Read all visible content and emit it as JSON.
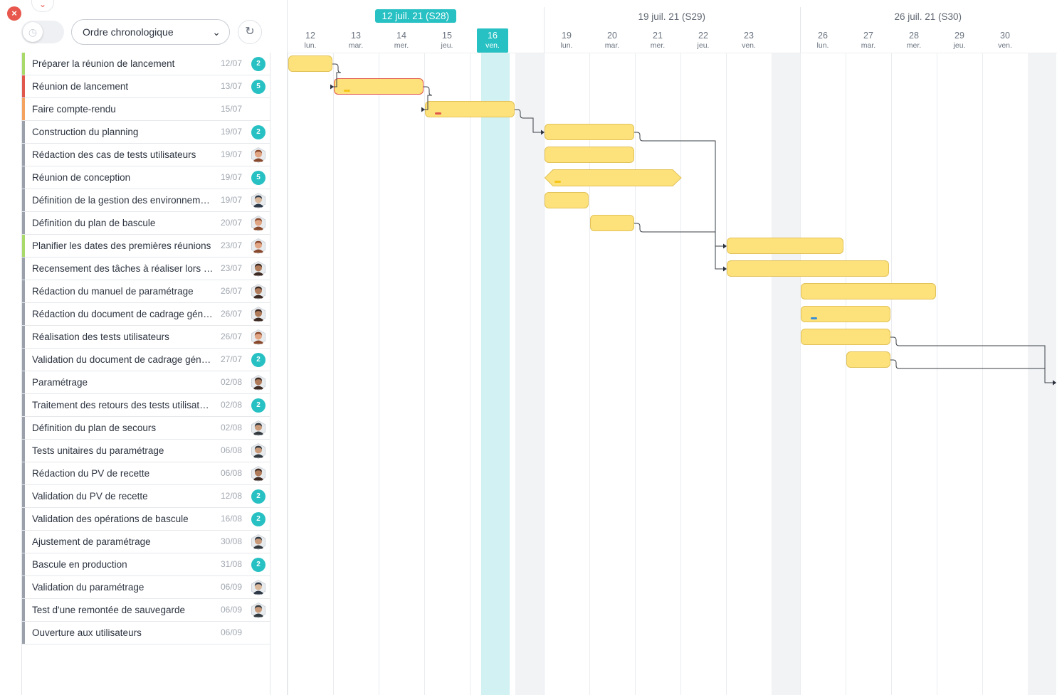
{
  "toolbar": {
    "close_label": "×",
    "collapse_label": "⌄",
    "sort_value": "Ordre chronologique",
    "refresh_label": "↻"
  },
  "tasks": [
    {
      "name": "Préparer la réunion de lancement",
      "date": "12/07",
      "stripe": "#a9d96b",
      "badge": "2"
    },
    {
      "name": "Réunion de lancement",
      "date": "13/07",
      "stripe": "#e0574b",
      "badge": "5"
    },
    {
      "name": "Faire compte-rendu",
      "date": "15/07",
      "stripe": "#f3a35f",
      "badge": ""
    },
    {
      "name": "Construction du planning",
      "date": "19/07",
      "stripe": "#9aa1ab",
      "badge": "2"
    },
    {
      "name": "Rédaction des cas de tests utilisateurs",
      "date": "19/07",
      "stripe": "#9aa1ab",
      "avatar": "woman"
    },
    {
      "name": "Réunion de conception",
      "date": "19/07",
      "stripe": "#9aa1ab",
      "badge": "5"
    },
    {
      "name": "Définition de la gestion des environnements",
      "date": "19/07",
      "stripe": "#9aa1ab",
      "avatar": "man-glasses"
    },
    {
      "name": "Définition du plan de bascule",
      "date": "20/07",
      "stripe": "#9aa1ab",
      "avatar": "woman"
    },
    {
      "name": "Planifier les dates des premières réunions",
      "date": "23/07",
      "stripe": "#a9d96b",
      "avatar": "woman"
    },
    {
      "name": "Recensement des tâches à réaliser lors de la bascule",
      "date": "23/07",
      "stripe": "#9aa1ab",
      "avatar": "man-dark"
    },
    {
      "name": "Rédaction du manuel de paramétrage",
      "date": "26/07",
      "stripe": "#9aa1ab",
      "avatar": "man-dark"
    },
    {
      "name": "Rédaction du document de cadrage général",
      "date": "26/07",
      "stripe": "#9aa1ab",
      "avatar": "man-dark"
    },
    {
      "name": "Réalisation des tests utilisateurs",
      "date": "26/07",
      "stripe": "#9aa1ab",
      "avatar": "woman"
    },
    {
      "name": "Validation du document de cadrage général",
      "date": "27/07",
      "stripe": "#9aa1ab",
      "badge": "2"
    },
    {
      "name": "Paramétrage",
      "date": "02/08",
      "stripe": "#9aa1ab",
      "avatar": "man-dark"
    },
    {
      "name": "Traitement des retours des tests utilisateurs",
      "date": "02/08",
      "stripe": "#9aa1ab",
      "badge": "2"
    },
    {
      "name": "Définition du plan de secours",
      "date": "02/08",
      "stripe": "#9aa1ab",
      "avatar": "man-beard"
    },
    {
      "name": "Tests unitaires du paramétrage",
      "date": "06/08",
      "stripe": "#9aa1ab",
      "avatar": "man-beard"
    },
    {
      "name": "Rédaction du PV de recette",
      "date": "06/08",
      "stripe": "#9aa1ab",
      "avatar": "man-dark"
    },
    {
      "name": "Validation du PV de recette",
      "date": "12/08",
      "stripe": "#9aa1ab",
      "badge": "2"
    },
    {
      "name": "Validation des opérations de bascule",
      "date": "16/08",
      "stripe": "#9aa1ab",
      "badge": "2"
    },
    {
      "name": "Ajustement de paramétrage",
      "date": "30/08",
      "stripe": "#9aa1ab",
      "avatar": "man-beard"
    },
    {
      "name": "Bascule en production",
      "date": "31/08",
      "stripe": "#9aa1ab",
      "badge": "2"
    },
    {
      "name": "Validation du paramétrage",
      "date": "06/09",
      "stripe": "#9aa1ab",
      "avatar": "man-glasses"
    },
    {
      "name": "Test d'une remontée de sauvegarde",
      "date": "06/09",
      "stripe": "#9aa1ab",
      "avatar": "man-beard"
    },
    {
      "name": "Ouverture aux utilisateurs",
      "date": "06/09",
      "stripe": "#9aa1ab",
      "badge": ""
    }
  ],
  "weeks": [
    {
      "label": "12 juil. 21 (S28)",
      "current": true
    },
    {
      "label": "19 juil. 21 (S29)",
      "current": false
    },
    {
      "label": "26 juil. 21 (S30)",
      "current": false
    }
  ],
  "days": [
    {
      "num": "12",
      "name": "lun."
    },
    {
      "num": "13",
      "name": "mar."
    },
    {
      "num": "14",
      "name": "mer."
    },
    {
      "num": "15",
      "name": "jeu."
    },
    {
      "num": "16",
      "name": "ven.",
      "today": true
    },
    {
      "num": "19",
      "name": "lun."
    },
    {
      "num": "20",
      "name": "mar."
    },
    {
      "num": "21",
      "name": "mer."
    },
    {
      "num": "22",
      "name": "jeu."
    },
    {
      "num": "23",
      "name": "ven."
    },
    {
      "num": "26",
      "name": "lun."
    },
    {
      "num": "27",
      "name": "mar."
    },
    {
      "num": "28",
      "name": "mer."
    },
    {
      "num": "29",
      "name": "jeu."
    },
    {
      "num": "30",
      "name": "ven."
    }
  ],
  "bars": [
    {
      "row": 0,
      "start": 0,
      "days": 1
    },
    {
      "row": 1,
      "start": 1,
      "days": 2,
      "border": "red",
      "mark": "#f5c518"
    },
    {
      "row": 2,
      "start": 3,
      "days": 2,
      "mark": "#e0574b"
    },
    {
      "row": 3,
      "start": 5,
      "days": 2
    },
    {
      "row": 4,
      "start": 5,
      "days": 2
    },
    {
      "row": 5,
      "start": 5,
      "days": 3,
      "shape": "hex",
      "mark": "#f5c518"
    },
    {
      "row": 6,
      "start": 5,
      "days": 1
    },
    {
      "row": 7,
      "start": 6,
      "days": 1
    },
    {
      "row": 8,
      "start": 9,
      "days": 2.6
    },
    {
      "row": 9,
      "start": 9,
      "days": 3.6
    },
    {
      "row": 10,
      "start": 10,
      "days": 3
    },
    {
      "row": 11,
      "start": 10,
      "days": 2,
      "mark": "#3a8fd6"
    },
    {
      "row": 12,
      "start": 10,
      "days": 2
    },
    {
      "row": 13,
      "start": 11,
      "days": 1
    }
  ],
  "links": [
    {
      "from": 0,
      "to": 1
    },
    {
      "from": 1,
      "to": 2
    },
    {
      "from": 2,
      "to": 3
    },
    {
      "from": 3,
      "to": 9
    },
    {
      "from": 7,
      "to": 8
    },
    {
      "from": 12,
      "to": 14
    },
    {
      "from": 13,
      "to": 14
    }
  ],
  "colors": {
    "accent": "#27c0c3",
    "bar_fill": "#fde17a",
    "bar_border": "#e2c25a",
    "close": "#e8574d"
  }
}
